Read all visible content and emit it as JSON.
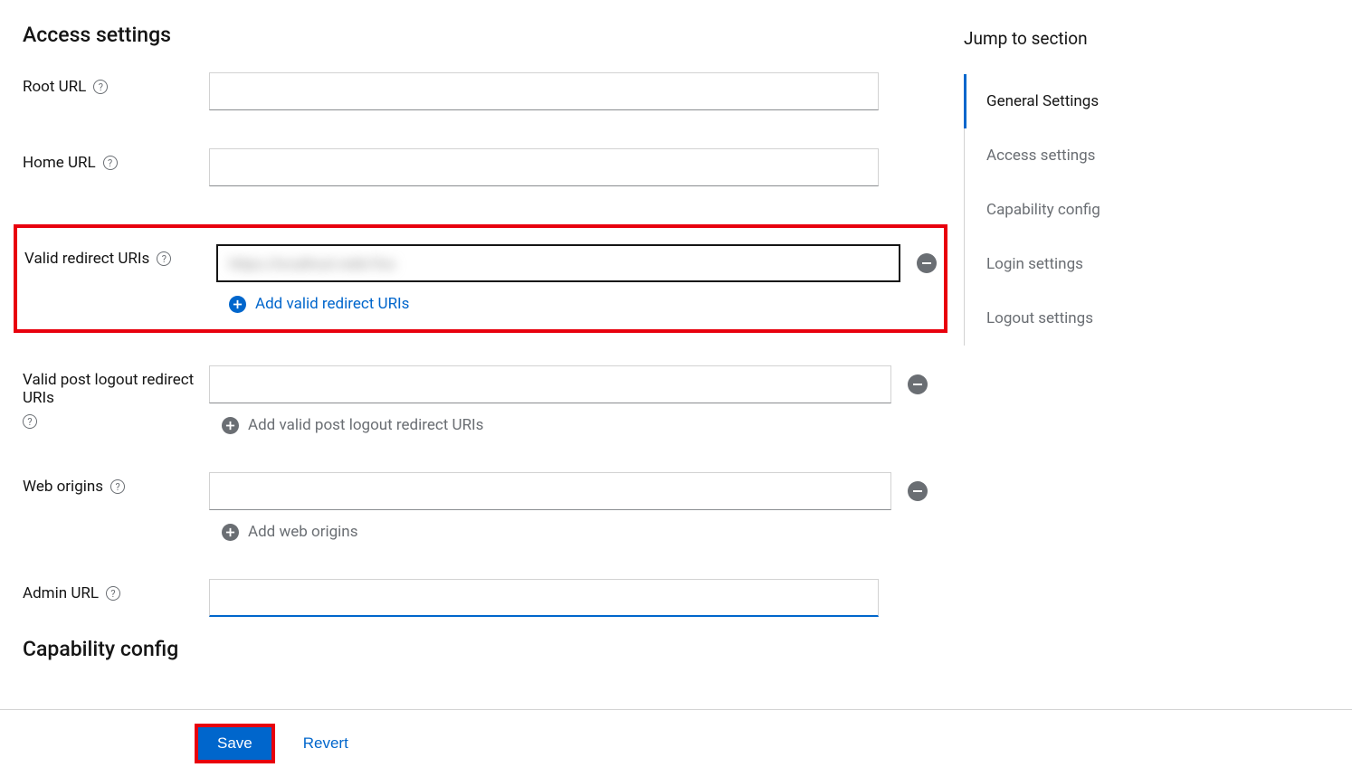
{
  "headings": {
    "access_settings": "Access settings",
    "capability_config": "Capability config"
  },
  "labels": {
    "root_url": "Root URL",
    "home_url": "Home URL",
    "valid_redirect_uris": "Valid redirect URIs",
    "valid_post_logout": "Valid post logout redirect URIs",
    "web_origins": "Web origins",
    "admin_url": "Admin URL"
  },
  "values": {
    "root_url": "",
    "home_url": "",
    "redirect_uri_0": "https://localhost.redir/foo",
    "post_logout_uri_0": "",
    "web_origin_0": "",
    "admin_url": ""
  },
  "add_links": {
    "add_redirect": "Add valid redirect URIs",
    "add_post_logout": "Add valid post logout redirect URIs",
    "add_web_origins": "Add web origins"
  },
  "buttons": {
    "save": "Save",
    "revert": "Revert"
  },
  "aside": {
    "title": "Jump to section",
    "items": [
      {
        "label": "General Settings",
        "active": true
      },
      {
        "label": "Access settings",
        "active": false
      },
      {
        "label": "Capability config",
        "active": false
      },
      {
        "label": "Login settings",
        "active": false
      },
      {
        "label": "Logout settings",
        "active": false
      }
    ]
  }
}
